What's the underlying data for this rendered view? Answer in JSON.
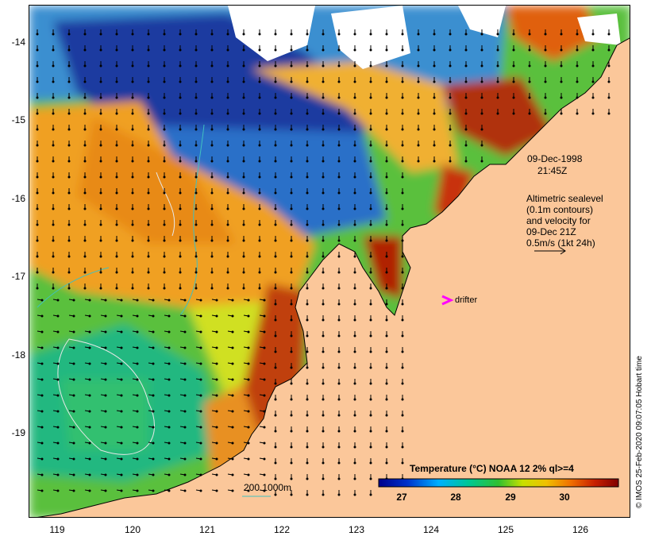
{
  "map": {
    "x_ticks": [
      "119",
      "120",
      "121",
      "122",
      "123",
      "124",
      "125",
      "126"
    ],
    "y_ticks": [
      "-14",
      "-15",
      "-16",
      "-17",
      "-18",
      "-19"
    ],
    "lon_range": [
      118.65,
      126.7
    ],
    "lat_range": [
      -13.65,
      -20.05
    ]
  },
  "annotations": {
    "date": "09-Dec-1998",
    "time": "21:45Z",
    "altimetric_lines": [
      "Altimetric sealevel",
      "(0.1m contours)",
      "and velocity for",
      "09-Dec 21Z",
      "0.5m/s (1kt 24h)"
    ],
    "drifter_label": "drifter",
    "bathymetry_label": "200  1000m"
  },
  "colorbar": {
    "title": "Temperature (°C) NOAA 12 2% ql>=4",
    "ticks": [
      "27",
      "28",
      "29",
      "30"
    ],
    "range": [
      26.7,
      30.6
    ]
  },
  "credit": "© IMOS 25-Feb-2020 09:07:05 Hobart time",
  "colors": {
    "land": "#fbc79a",
    "drifter": "#ff00ff",
    "bathy_contour": "#40c0c0",
    "ssh_contour": "#e8e8e8"
  }
}
